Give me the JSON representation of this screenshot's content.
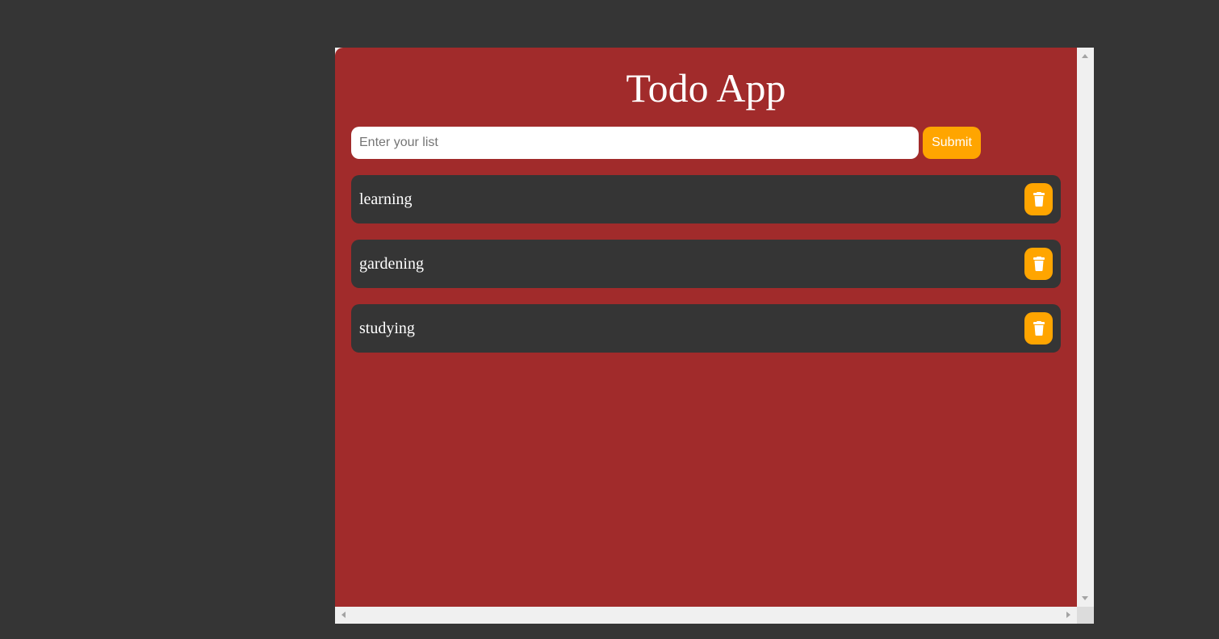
{
  "app": {
    "title": "Todo App",
    "input": {
      "placeholder": "Enter your list",
      "value": ""
    },
    "submit_label": "Submit",
    "todos": [
      {
        "label": "learning",
        "delete_icon": "trash-icon"
      },
      {
        "label": "gardening",
        "delete_icon": "trash-icon"
      },
      {
        "label": "studying",
        "delete_icon": "trash-icon"
      }
    ]
  },
  "colors": {
    "page_background": "#353535",
    "app_background": "#a12b2b",
    "item_background": "#353535",
    "accent": "#ffa500",
    "text": "#ffffff"
  }
}
